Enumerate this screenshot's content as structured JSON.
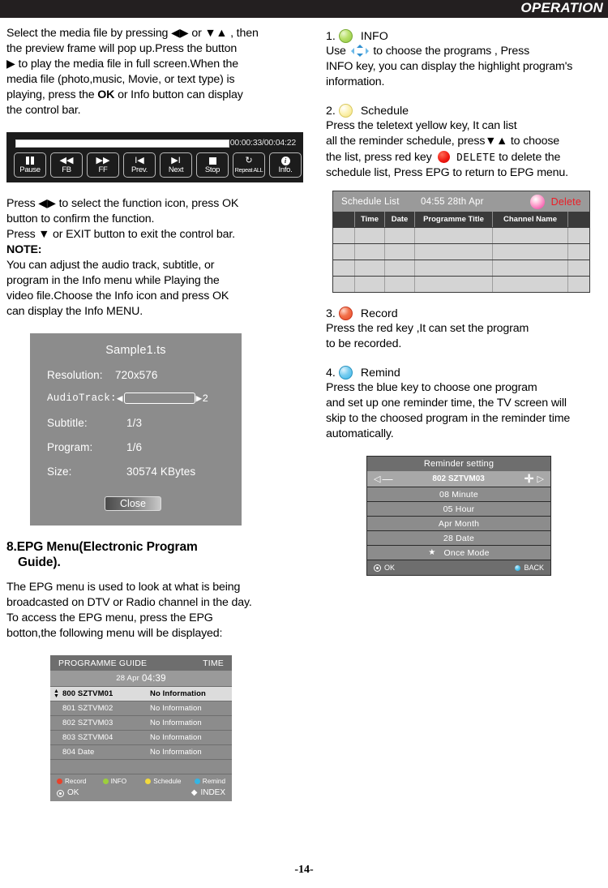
{
  "header": {
    "title": "OPERATION"
  },
  "page_number": "-14-",
  "left": {
    "intro_lines": [
      "Select the media file by pressing  ◀▶ or ▼▲ , then",
      "the preview frame will pop up.Press the button",
      " ▶ to play the media file in full screen.When the",
      "media file (photo,music, Movie, or text type) is",
      "playing, press the OK or Info button can display",
      "the control bar."
    ],
    "intro_bold_word": "OK",
    "media_bar": {
      "time": "00:00:33/00:04:22",
      "buttons": [
        {
          "label": "Pause",
          "icon": "pause-icon"
        },
        {
          "label": "FB",
          "icon": "rewind-icon",
          "glyph": "◀◀"
        },
        {
          "label": "FF",
          "icon": "fast-forward-icon",
          "glyph": "▶▶"
        },
        {
          "label": "Prev.",
          "icon": "previous-icon",
          "glyph": "I◀"
        },
        {
          "label": "Next",
          "icon": "next-icon",
          "glyph": "▶I"
        },
        {
          "label": "Stop",
          "icon": "stop-icon"
        },
        {
          "label": "Repeat ALL",
          "icon": "repeat-icon",
          "glyph": "↻"
        },
        {
          "label": "Info.",
          "icon": "info-icon"
        }
      ]
    },
    "mid_lines": [
      "Press ◀▶ to select the function icon, press OK",
      "button to confirm the function.",
      "Press  ▼  or EXIT button to exit the control bar."
    ],
    "note_label": "NOTE:",
    "note_lines": [
      "You can adjust the audio track, subtitle, or",
      "program in the Info menu while Playing the",
      "video file.Choose the Info icon and press OK",
      "can display the Info MENU."
    ],
    "info_panel": {
      "title": "Sample1.ts",
      "resolution_label": "Resolution:",
      "resolution_value": "720x576",
      "audiotrack_label": "AudioTrack:",
      "audiotrack_left_arrow": "◀",
      "audiotrack_value": "",
      "audiotrack_right": "▶2",
      "rows": [
        {
          "key": "Subtitle:",
          "value": "1/3"
        },
        {
          "key": "Program:",
          "value": "1/6"
        },
        {
          "key": "Size:",
          "value": "30574 KBytes"
        }
      ],
      "close_label": "Close"
    },
    "epg_heading_line1": "8.EPG Menu(Electronic Program",
    "epg_heading_line2": "Guide).",
    "epg_desc_lines": [
      "The EPG menu is used to look at what is being",
      "broadcasted on DTV or Radio channel  in the day.",
      "To access the EPG menu, press the EPG",
      "botton,the following menu will be displayed:"
    ],
    "programme_guide": {
      "title": "PROGRAMME GUIDE",
      "time_col": "TIME",
      "date": "28 Apr",
      "clock": "04:39",
      "rows": [
        {
          "channel": "800 SZTVM01",
          "info": "No Information",
          "selected": true
        },
        {
          "channel": "801 SZTVM02",
          "info": "No Information",
          "selected": false
        },
        {
          "channel": "802 SZTVM03",
          "info": "No Information",
          "selected": false
        },
        {
          "channel": "803 SZTVM04",
          "info": "No Information",
          "selected": false
        },
        {
          "channel": "804 Date",
          "info": "No Information",
          "selected": false
        }
      ],
      "keys": [
        {
          "label": "Record",
          "color": "#e8412a"
        },
        {
          "label": "INFO",
          "color": "#9ccf3c"
        },
        {
          "label": "Schedule",
          "color": "#f2d93c"
        },
        {
          "label": "Remind",
          "color": "#34b5e4"
        }
      ],
      "ok_label": "OK",
      "index_label": "INDEX",
      "index_glyph": "◆"
    }
  },
  "right": {
    "items": [
      {
        "num": "1.",
        "label": "INFO",
        "ball": "green-circle-icon",
        "lines": [
          "Use  ✥ to choose the programs , Press",
          "INFO key, you  can display the highlight  program's",
          "information."
        ]
      },
      {
        "num": "2.",
        "label": "Schedule",
        "ball": "yellow-circle-icon",
        "lines": [
          "Press  the  teletext yellow key, It can list",
          "all the reminder schedule, press▼▲  to choose",
          "the list,  press red key ● DELETE  to delete the",
          "schedule list, Press EPG  to return to EPG  menu."
        ],
        "delete_word": "DELETE"
      },
      {
        "num": "3.",
        "label": "Record",
        "ball": "red-circle-icon",
        "lines": [
          "Press  the  red key ,It can set the program",
          "to be recorded."
        ]
      },
      {
        "num": "4.",
        "label": "Remind",
        "ball": "blue-circle-icon",
        "lines": [
          "Press the blue key to choose one program",
          "and set up one reminder time, the TV screen will",
          "skip to the choosed program in the reminder time",
          "automatically."
        ]
      }
    ],
    "schedule_list": {
      "title": "Schedule List",
      "time": "04:55  28th Apr",
      "delete_label": "Delete",
      "columns": [
        "",
        "Time",
        "Date",
        "Programme Title",
        "Channel Name",
        ""
      ],
      "rows": [
        [
          "",
          "",
          "",
          "",
          "",
          ""
        ],
        [
          "",
          "",
          "",
          "",
          "",
          ""
        ],
        [
          "",
          "",
          "",
          "",
          "",
          ""
        ],
        [
          "",
          "",
          "",
          "",
          "",
          ""
        ]
      ]
    },
    "reminder_setting": {
      "title": "Reminder setting",
      "left_arrow": "◁",
      "minus": "—",
      "channel": "802 SZTVM03",
      "plus": "✛",
      "right_arrow": "▷",
      "rows": [
        {
          "text": "08 Minute",
          "star": false
        },
        {
          "text": "05 Hour",
          "star": false
        },
        {
          "text": "Apr Month",
          "star": false
        },
        {
          "text": "28 Date",
          "star": false
        },
        {
          "text": "Once Mode",
          "star": true
        }
      ],
      "ok_label": "OK",
      "back_label": "BACK"
    }
  }
}
